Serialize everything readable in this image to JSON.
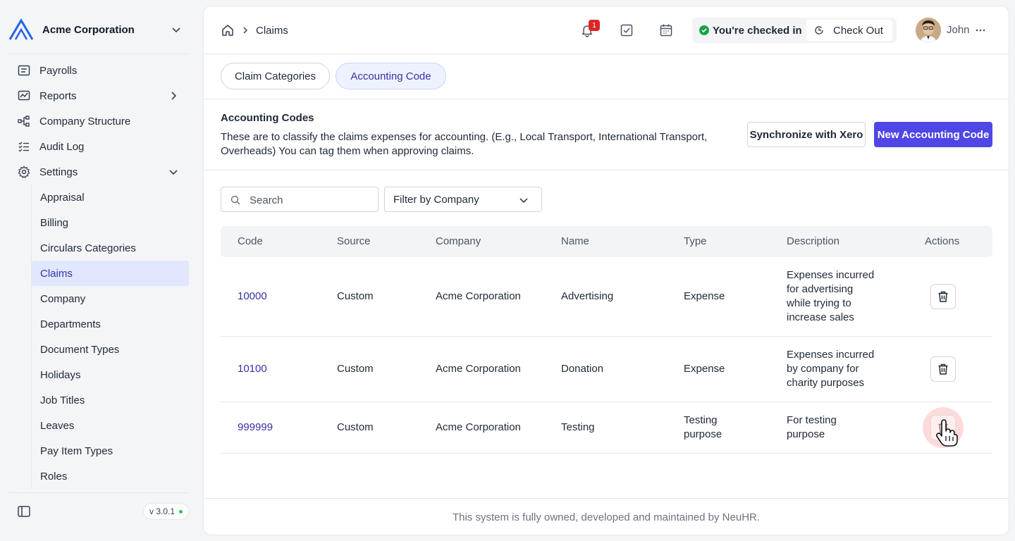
{
  "sidebar": {
    "company": "Acme Corporation",
    "nav": [
      {
        "label": "Payrolls",
        "icon": "payroll-icon"
      },
      {
        "label": "Reports",
        "icon": "reports-icon"
      },
      {
        "label": "Company Structure",
        "icon": "structure-icon"
      },
      {
        "label": "Audit Log",
        "icon": "audit-icon"
      },
      {
        "label": "Settings",
        "icon": "gear-icon"
      }
    ],
    "settings_items": [
      "Appraisal",
      "Billing",
      "Circulars Categories",
      "Claims",
      "Company",
      "Departments",
      "Document Types",
      "Holidays",
      "Job Titles",
      "Leaves",
      "Pay Item Types",
      "Roles"
    ],
    "active_item": "Claims",
    "version": "v 3.0.1"
  },
  "header": {
    "breadcrumb": "Claims",
    "notification_count": "1",
    "checkin_status": "You're checked in",
    "checkout_label": "Check Out",
    "user_name": "John"
  },
  "tabs": [
    {
      "label": "Claim Categories",
      "active": false
    },
    {
      "label": "Accounting Code",
      "active": true
    }
  ],
  "section": {
    "title": "Accounting Codes",
    "description": "These are to classify the claims expenses for accounting. (E.g., Local Transport, International Transport, Overheads) You can tag them when approving claims.",
    "sync_label": "Synchronize with Xero",
    "new_label": "New Accounting Code"
  },
  "filters": {
    "search_placeholder": "Search",
    "company_filter": "Filter by Company"
  },
  "table": {
    "headers": [
      "Code",
      "Source",
      "Company",
      "Name",
      "Type",
      "Description",
      "Actions"
    ],
    "rows": [
      {
        "code": "10000",
        "source": "Custom",
        "company": "Acme Corporation",
        "name": "Advertising",
        "type": "Expense",
        "description": "Expenses incurred for advertising while trying to increase sales"
      },
      {
        "code": "10100",
        "source": "Custom",
        "company": "Acme Corporation",
        "name": "Donation",
        "type": "Expense",
        "description": "Expenses incurred by company for charity purposes"
      },
      {
        "code": "999999",
        "source": "Custom",
        "company": "Acme Corporation",
        "name": "Testing",
        "type": "Testing purpose",
        "description": "For testing purpose"
      }
    ]
  },
  "footer": {
    "text": "This system is fully owned, developed and maintained by NeuHR."
  },
  "colors": {
    "accent": "#4f46e5",
    "active_bg": "#e0e7ff",
    "link": "#3730a3",
    "danger": "#dc2626",
    "success": "#16a34a"
  }
}
